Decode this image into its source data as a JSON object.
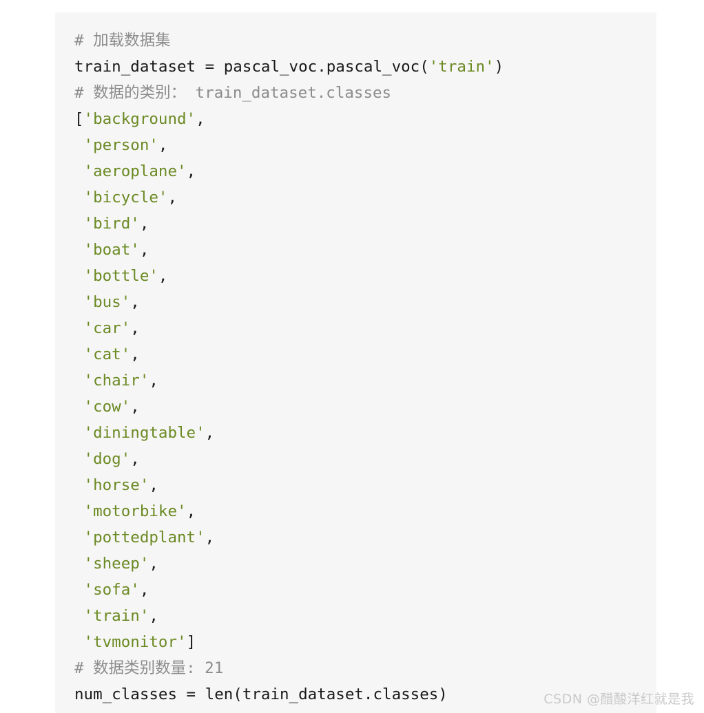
{
  "page": {
    "background_color": "#ffffff"
  },
  "code_block": {
    "background_color": "#f6f6f6",
    "language": "python",
    "colors": {
      "comment": "#8c8c8c",
      "string": "#6b8a23",
      "plain": "#1a1a1a"
    },
    "lines": [
      {
        "indent": "",
        "segments": [
          {
            "type": "comment",
            "text": "# 加载数据集"
          }
        ]
      },
      {
        "indent": "",
        "segments": [
          {
            "type": "plain",
            "text": "train_dataset = pascal_voc.pascal_voc("
          },
          {
            "type": "string",
            "text": "'train'"
          },
          {
            "type": "plain",
            "text": ")"
          }
        ]
      },
      {
        "indent": "",
        "segments": [
          {
            "type": "comment",
            "text": "# 数据的类别： train_dataset.classes"
          }
        ]
      },
      {
        "indent": "",
        "segments": [
          {
            "type": "plain",
            "text": "["
          },
          {
            "type": "string",
            "text": "'background'"
          },
          {
            "type": "plain",
            "text": ","
          }
        ]
      },
      {
        "indent": " ",
        "segments": [
          {
            "type": "string",
            "text": "'person'"
          },
          {
            "type": "plain",
            "text": ","
          }
        ]
      },
      {
        "indent": " ",
        "segments": [
          {
            "type": "string",
            "text": "'aeroplane'"
          },
          {
            "type": "plain",
            "text": ","
          }
        ]
      },
      {
        "indent": " ",
        "segments": [
          {
            "type": "string",
            "text": "'bicycle'"
          },
          {
            "type": "plain",
            "text": ","
          }
        ]
      },
      {
        "indent": " ",
        "segments": [
          {
            "type": "string",
            "text": "'bird'"
          },
          {
            "type": "plain",
            "text": ","
          }
        ]
      },
      {
        "indent": " ",
        "segments": [
          {
            "type": "string",
            "text": "'boat'"
          },
          {
            "type": "plain",
            "text": ","
          }
        ]
      },
      {
        "indent": " ",
        "segments": [
          {
            "type": "string",
            "text": "'bottle'"
          },
          {
            "type": "plain",
            "text": ","
          }
        ]
      },
      {
        "indent": " ",
        "segments": [
          {
            "type": "string",
            "text": "'bus'"
          },
          {
            "type": "plain",
            "text": ","
          }
        ]
      },
      {
        "indent": " ",
        "segments": [
          {
            "type": "string",
            "text": "'car'"
          },
          {
            "type": "plain",
            "text": ","
          }
        ]
      },
      {
        "indent": " ",
        "segments": [
          {
            "type": "string",
            "text": "'cat'"
          },
          {
            "type": "plain",
            "text": ","
          }
        ]
      },
      {
        "indent": " ",
        "segments": [
          {
            "type": "string",
            "text": "'chair'"
          },
          {
            "type": "plain",
            "text": ","
          }
        ]
      },
      {
        "indent": " ",
        "segments": [
          {
            "type": "string",
            "text": "'cow'"
          },
          {
            "type": "plain",
            "text": ","
          }
        ]
      },
      {
        "indent": " ",
        "segments": [
          {
            "type": "string",
            "text": "'diningtable'"
          },
          {
            "type": "plain",
            "text": ","
          }
        ]
      },
      {
        "indent": " ",
        "segments": [
          {
            "type": "string",
            "text": "'dog'"
          },
          {
            "type": "plain",
            "text": ","
          }
        ]
      },
      {
        "indent": " ",
        "segments": [
          {
            "type": "string",
            "text": "'horse'"
          },
          {
            "type": "plain",
            "text": ","
          }
        ]
      },
      {
        "indent": " ",
        "segments": [
          {
            "type": "string",
            "text": "'motorbike'"
          },
          {
            "type": "plain",
            "text": ","
          }
        ]
      },
      {
        "indent": " ",
        "segments": [
          {
            "type": "string",
            "text": "'pottedplant'"
          },
          {
            "type": "plain",
            "text": ","
          }
        ]
      },
      {
        "indent": " ",
        "segments": [
          {
            "type": "string",
            "text": "'sheep'"
          },
          {
            "type": "plain",
            "text": ","
          }
        ]
      },
      {
        "indent": " ",
        "segments": [
          {
            "type": "string",
            "text": "'sofa'"
          },
          {
            "type": "plain",
            "text": ","
          }
        ]
      },
      {
        "indent": " ",
        "segments": [
          {
            "type": "string",
            "text": "'train'"
          },
          {
            "type": "plain",
            "text": ","
          }
        ]
      },
      {
        "indent": " ",
        "segments": [
          {
            "type": "string",
            "text": "'tvmonitor'"
          },
          {
            "type": "plain",
            "text": "]"
          }
        ]
      },
      {
        "indent": "",
        "segments": [
          {
            "type": "comment",
            "text": "# 数据类别数量: 21"
          }
        ]
      },
      {
        "indent": "",
        "segments": [
          {
            "type": "plain",
            "text": "num_classes = len(train_dataset.classes)"
          }
        ]
      }
    ],
    "class_list": [
      "background",
      "person",
      "aeroplane",
      "bicycle",
      "bird",
      "boat",
      "bottle",
      "bus",
      "car",
      "cat",
      "chair",
      "cow",
      "diningtable",
      "dog",
      "horse",
      "motorbike",
      "pottedplant",
      "sheep",
      "sofa",
      "train",
      "tvmonitor"
    ],
    "num_classes": 21
  },
  "watermark": {
    "text": "CSDN @醋酸洋红就是我",
    "color": "#c9c9c9"
  }
}
